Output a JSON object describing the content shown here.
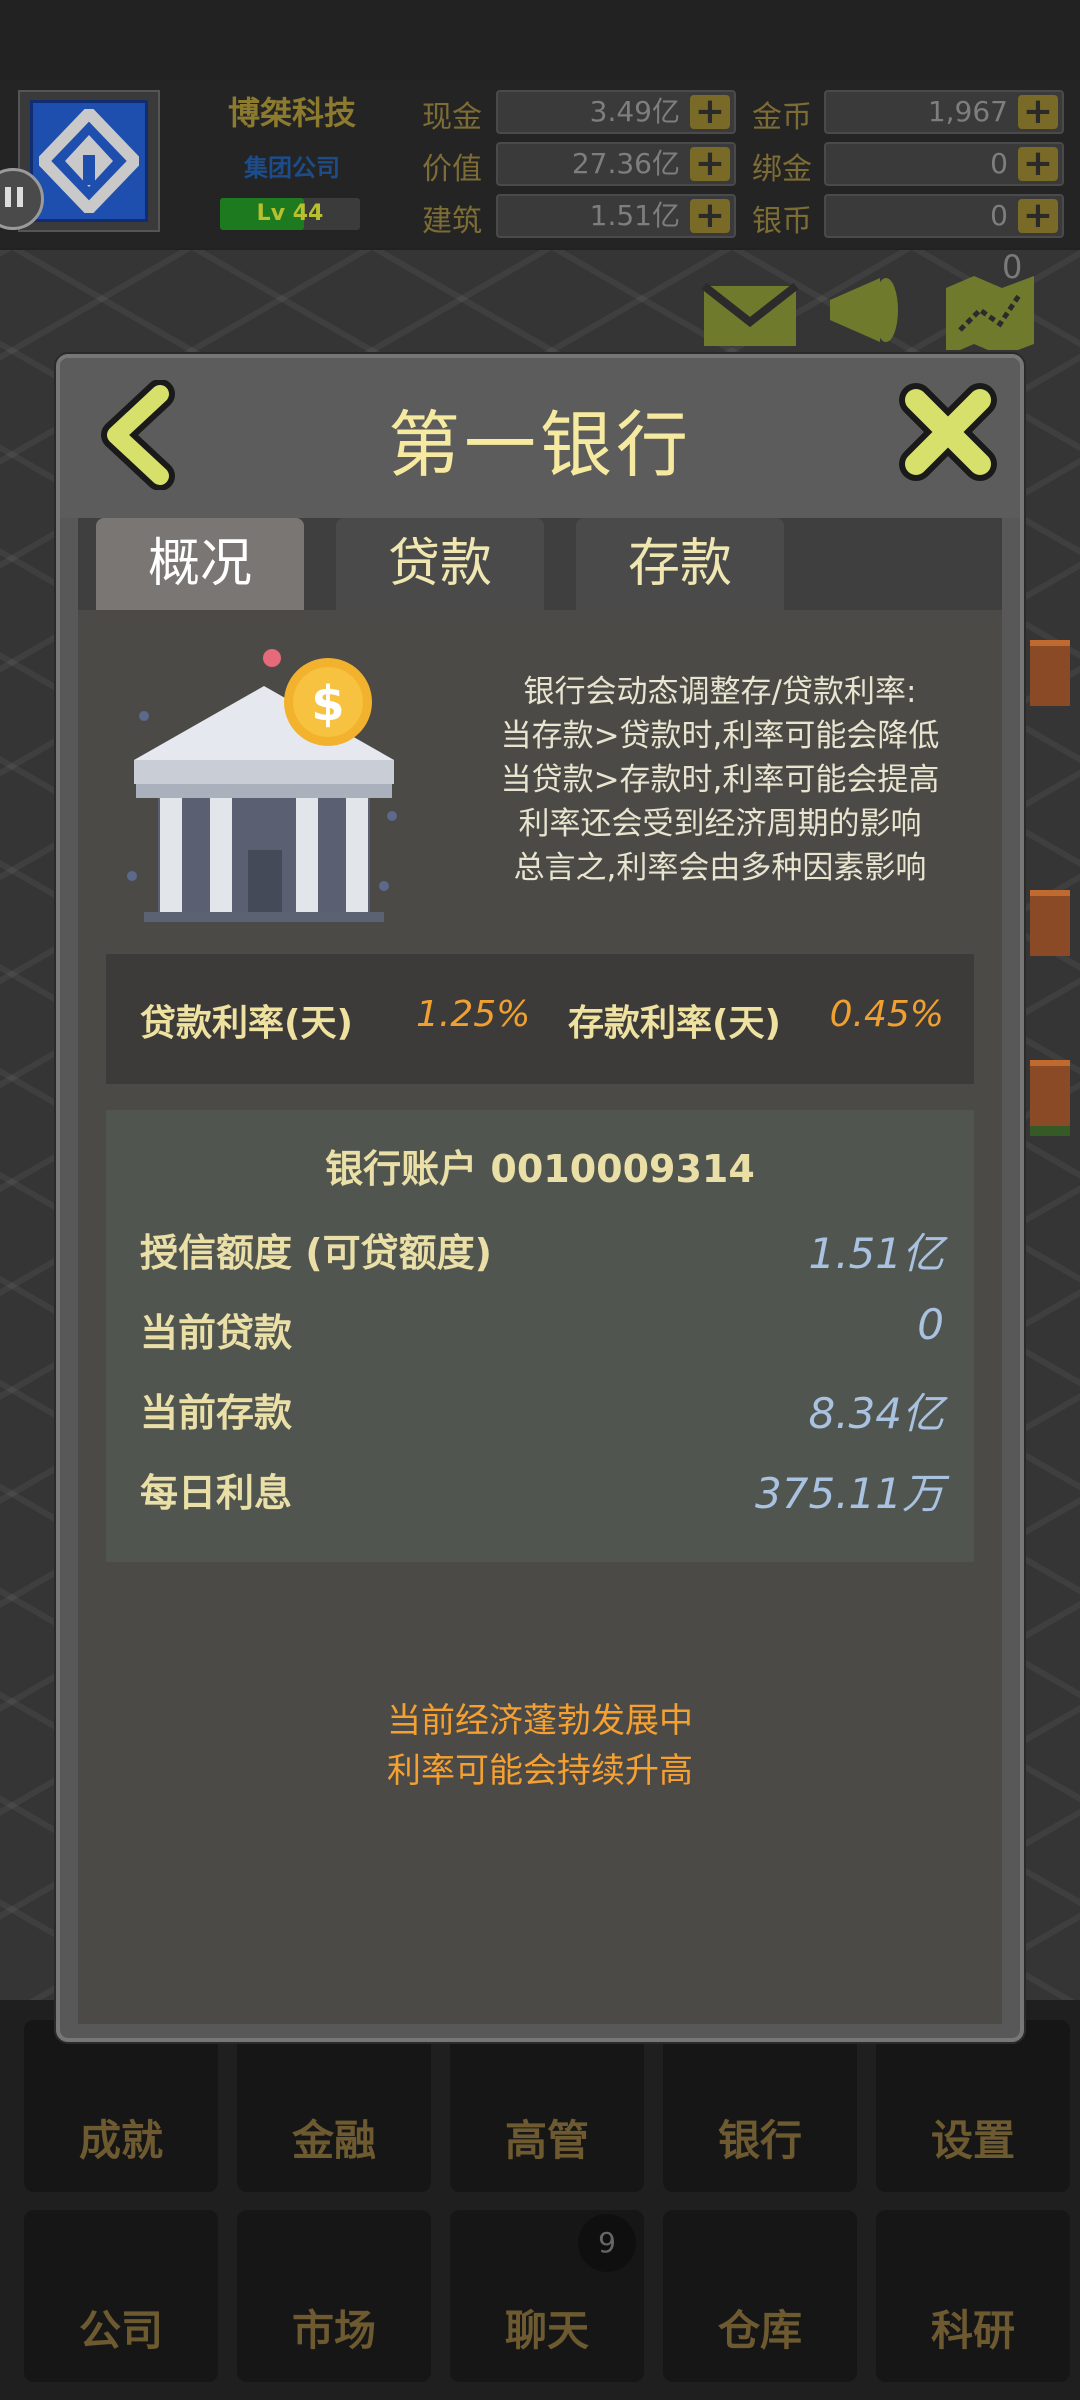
{
  "header": {
    "company_name": "博桀科技",
    "company_type": "集团公司",
    "level": "Lv 44",
    "level_progress": 0.6,
    "resources": [
      {
        "label": "现金",
        "value": "3.49亿"
      },
      {
        "label": "价值",
        "value": "27.36亿"
      },
      {
        "label": "建筑",
        "value": "1.51亿"
      },
      {
        "label": "金币",
        "value": "1,967"
      },
      {
        "label": "绑金",
        "value": "0"
      },
      {
        "label": "银币",
        "value": "0"
      }
    ],
    "plus_symbol": "+",
    "notification_count": "0",
    "icons": [
      "mail-icon",
      "megaphone-icon",
      "map-icon"
    ]
  },
  "dialog": {
    "title": "第一银行",
    "tabs": [
      {
        "label": "概况",
        "active": true
      },
      {
        "label": "贷款",
        "active": false
      },
      {
        "label": "存款",
        "active": false
      }
    ],
    "description": [
      "银行会动态调整存/贷款利率:",
      "当存款>贷款时,利率可能会降低",
      "当贷款>存款时,利率可能会提高",
      "利率还会受到经济周期的影响",
      "总言之,利率会由多种因素影响"
    ],
    "rates": {
      "loan_label": "贷款利率(天)",
      "loan_value": "1.25%",
      "deposit_label": "存款利率(天)",
      "deposit_value": "0.45%"
    },
    "account": {
      "title": "银行账户 0010009314",
      "rows": [
        {
          "label": "授信额度 (可贷额度)",
          "value": "1.51亿"
        },
        {
          "label": "当前贷款",
          "value": "0"
        },
        {
          "label": "当前存款",
          "value": "8.34亿"
        },
        {
          "label": "每日利息",
          "value": "375.11万"
        }
      ]
    },
    "notice": [
      "当前经济蓬勃发展中",
      "利率可能会持续升高"
    ]
  },
  "menu": {
    "row1": [
      "成就",
      "金融",
      "高管",
      "银行",
      "设置"
    ],
    "row2": [
      "公司",
      "市场",
      "聊天",
      "仓库",
      "科研"
    ],
    "chat_badge": "9"
  },
  "colors": {
    "title": "#f6eaa0",
    "rate_value": "#f0a030",
    "account_value": "#a9c2e0",
    "notice": "#f5a030"
  }
}
